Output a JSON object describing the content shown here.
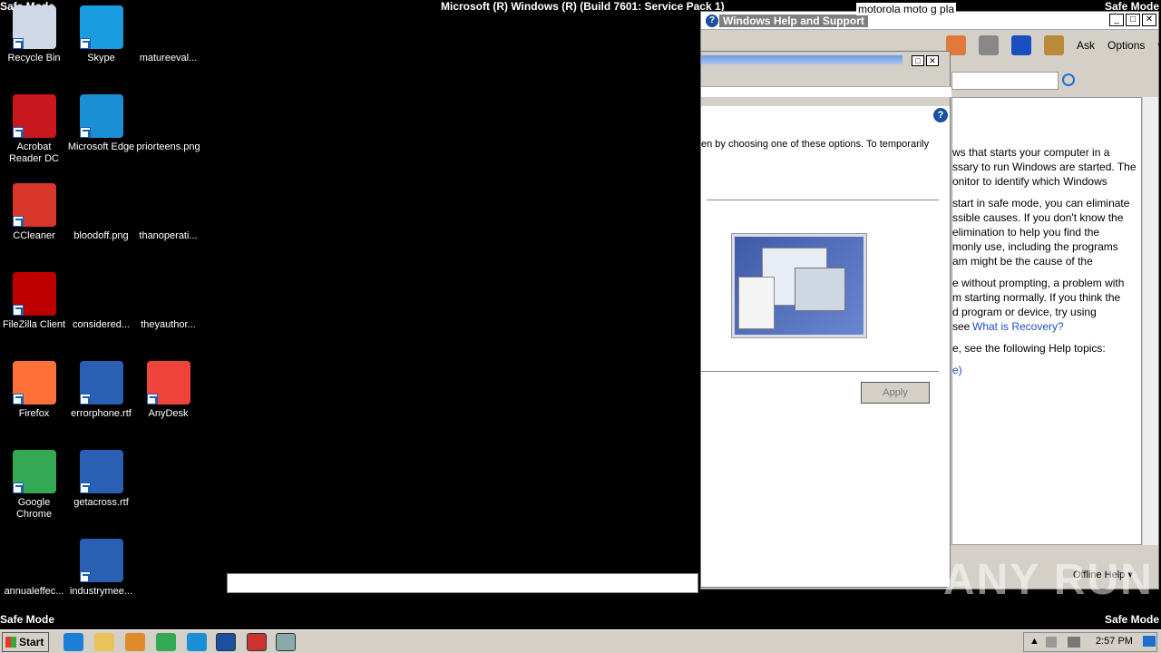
{
  "safe_mode_label": "Safe Mode",
  "build_text": "Microsoft (R) Windows (R) (Build 7601: Service Pack 1)",
  "desktop_icons": [
    {
      "label": "Recycle Bin",
      "icon": "recycle-bin-icon",
      "color": "#cfd8e6"
    },
    {
      "label": "Skype",
      "icon": "skype-icon",
      "color": "#1a9de0"
    },
    {
      "label": "matureeval...",
      "icon": "png-file-icon",
      "color": "#000000"
    },
    {
      "label": "Acrobat Reader DC",
      "icon": "acrobat-icon",
      "color": "#c9171e"
    },
    {
      "label": "Microsoft Edge",
      "icon": "edge-icon",
      "color": "#1a8fd6"
    },
    {
      "label": "priorteens.png",
      "icon": "png-file-icon",
      "color": "#000000"
    },
    {
      "label": "CCleaner",
      "icon": "ccleaner-icon",
      "color": "#d9362b"
    },
    {
      "label": "bloodoff.png",
      "icon": "png-file-icon",
      "color": "#000000"
    },
    {
      "label": "thanoperati...",
      "icon": "file-icon",
      "color": "#000000"
    },
    {
      "label": "FileZilla Client",
      "icon": "filezilla-icon",
      "color": "#bf0000"
    },
    {
      "label": "considered...",
      "icon": "file-icon",
      "color": "#000000"
    },
    {
      "label": "theyauthor...",
      "icon": "file-icon",
      "color": "#000000"
    },
    {
      "label": "Firefox",
      "icon": "firefox-icon",
      "color": "#ff7139"
    },
    {
      "label": "errorphone.rtf",
      "icon": "word-doc-icon",
      "color": "#2b5fb3"
    },
    {
      "label": "AnyDesk",
      "icon": "anydesk-icon",
      "color": "#ef443b"
    },
    {
      "label": "Google Chrome",
      "icon": "chrome-icon",
      "color": "#34a853"
    },
    {
      "label": "getacross.rtf",
      "icon": "word-doc-icon",
      "color": "#2b5fb3"
    },
    {
      "label": "annualeffec...",
      "icon": "file-icon",
      "color": "#000000"
    },
    {
      "label": "industrymee...",
      "icon": "word-doc-icon",
      "color": "#2b5fb3"
    }
  ],
  "help_window": {
    "title": "Windows Help and Support",
    "ask_label": "Ask",
    "options_label": "Options",
    "paragraphs": [
      "ws that starts your computer in a\nssary to run Windows are started. The\nonitor to identify which Windows",
      "start in safe mode, you can eliminate\nssible causes. If you don't know the\nelimination to help you find the\nmonly use, including the programs\nam might be the cause of the",
      "e without prompting, a problem with\nm starting normally. If you think the\nd program or device, try using\nsee"
    ],
    "recovery_link": "What is Recovery?",
    "topics_text": "e, see the following Help topics:",
    "topics_link": "e)",
    "offline_help": "Offline Help"
  },
  "dialog": {
    "text": "en by choosing one of these options. To temporarily",
    "apply_label": "Apply"
  },
  "motorola_text": "motorola moto g pla",
  "taskbar": {
    "start_label": "Start",
    "clock": "2:57 PM"
  },
  "watermark": "ANY RUN"
}
